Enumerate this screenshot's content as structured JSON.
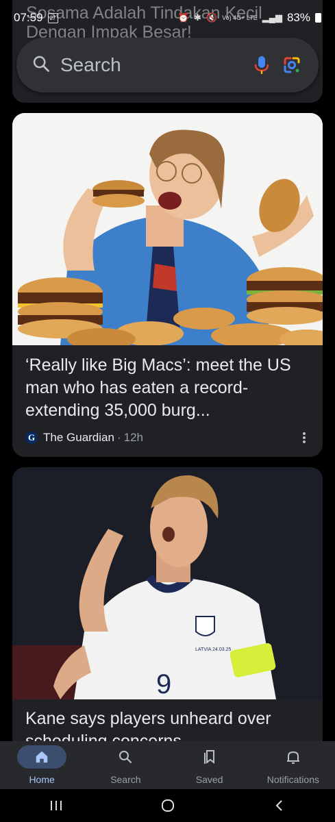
{
  "status_bar": {
    "time": "07:59",
    "calendar_day": "27",
    "network": "Vo) 4G+ LTE",
    "battery": "83%"
  },
  "previous_card": {
    "title": "Sosama Adalah Tindakan Kecil Dengan Impak Besar!"
  },
  "search": {
    "placeholder": "Search"
  },
  "cards": [
    {
      "title": "‘Really like Big Macs’: meet the US man who has eaten a record-extending 35,000 burg...",
      "source": "The Guardian",
      "source_logo": "G",
      "separator": "·",
      "age": "12h",
      "image_icon": "burger-man-photo"
    },
    {
      "title": "Kane says players unheard over scheduling concerns",
      "image_icon": "footballer-photo",
      "shirt_number": "9",
      "shirt_text": "LATVIA 24.03.25"
    }
  ],
  "bottom_nav": [
    {
      "label": "Home",
      "icon": "home-icon",
      "active": true
    },
    {
      "label": "Search",
      "icon": "search-icon",
      "active": false
    },
    {
      "label": "Saved",
      "icon": "bookmark-icon",
      "active": false
    },
    {
      "label": "Notifications",
      "icon": "bell-icon",
      "active": false
    }
  ],
  "colors": {
    "background": "#000000",
    "card": "#202124",
    "accent": "#a8c7fa",
    "active_pill": "#3c4e6e"
  }
}
